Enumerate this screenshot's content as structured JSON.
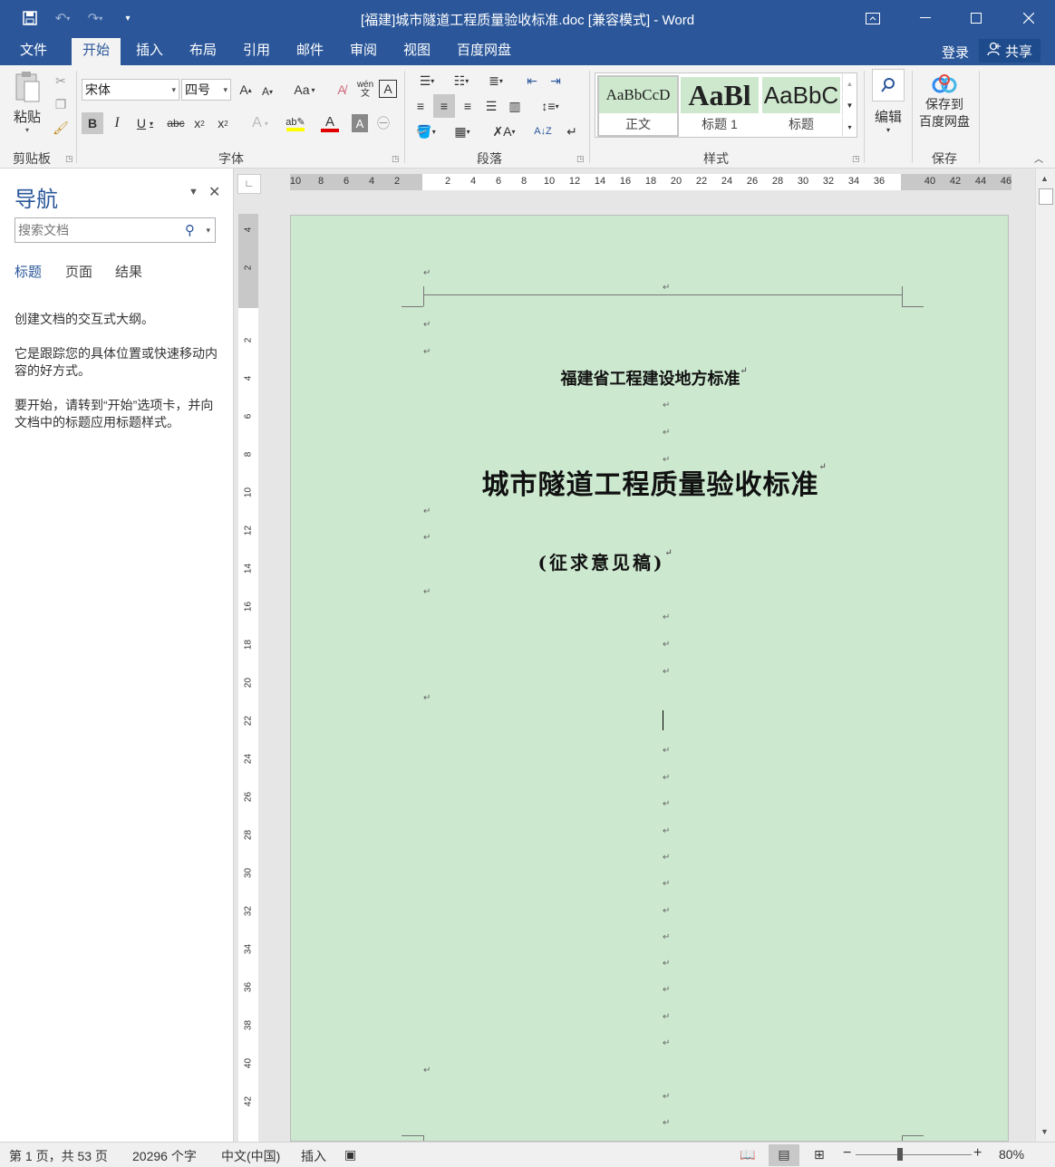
{
  "window": {
    "title": "[福建]城市隧道工程质量验收标准.doc [兼容模式] - Word",
    "qat": [
      "save-icon",
      "undo-icon",
      "redo-icon",
      "customize-icon"
    ],
    "controls": [
      "ribbon-display-icon",
      "minimize-icon",
      "maximize-icon",
      "close-icon"
    ]
  },
  "ribbon_tabs": {
    "file": "文件",
    "home": "开始",
    "insert": "插入",
    "layout": "布局",
    "references": "引用",
    "mailings": "邮件",
    "review": "审阅",
    "view": "视图",
    "baidu": "百度网盘",
    "login": "登录",
    "share": "共享"
  },
  "ribbon": {
    "clipboard": {
      "paste": "粘贴",
      "label": "剪贴板"
    },
    "font": {
      "name": "宋体",
      "size": "四号",
      "label": "字体",
      "case": "Aa",
      "phonetic": "wén\n文",
      "border_char": "A"
    },
    "paragraph": {
      "label": "段落"
    },
    "styles": {
      "label": "样式",
      "tiles": [
        {
          "preview": "AaBbCcD",
          "name": "正文"
        },
        {
          "preview": "AaBl",
          "name": "标题 1"
        },
        {
          "preview": "AaBbC",
          "name": "标题"
        }
      ]
    },
    "editing": {
      "label": "编辑"
    },
    "save": {
      "line1": "保存到",
      "line2": "百度网盘",
      "label": "保存"
    }
  },
  "navigation": {
    "title": "导航",
    "search_placeholder": "搜索文档",
    "tabs": [
      "标题",
      "页面",
      "结果"
    ],
    "para1": "创建文档的交互式大纲。",
    "para2": "它是跟踪您的具体位置或快速移动内容的好方式。",
    "para3": "要开始，请转到“开始”选项卡，并向文档中的标题应用标题样式。"
  },
  "rulers": {
    "horizontal": [
      "10",
      "8",
      "6",
      "4",
      "2",
      "2",
      "4",
      "6",
      "8",
      "10",
      "12",
      "14",
      "16",
      "18",
      "20",
      "22",
      "24",
      "26",
      "28",
      "30",
      "32",
      "34",
      "36",
      "40",
      "42",
      "44",
      "46"
    ],
    "vertical": [
      "4",
      "2",
      "2",
      "4",
      "6",
      "8",
      "10",
      "12",
      "14",
      "16",
      "18",
      "20",
      "22",
      "24",
      "26",
      "28",
      "30",
      "32",
      "34",
      "36",
      "38",
      "40",
      "42"
    ]
  },
  "document": {
    "org_line": "福建省工程建设地方标准",
    "main_title": "城市隧道工程质量验收标准",
    "draft_note": "(征求意见稿)",
    "para_mark": "↵"
  },
  "status_bar": {
    "page": "第 1 页，共 53 页",
    "words": "20296 个字",
    "language": "中文(中国)",
    "mode": "插入",
    "zoom": "80%",
    "zoom_level": 0.8
  },
  "colors": {
    "accent": "#2b579a",
    "page_bg": "#cce8cf",
    "style_highlight": "#cde8cd"
  }
}
